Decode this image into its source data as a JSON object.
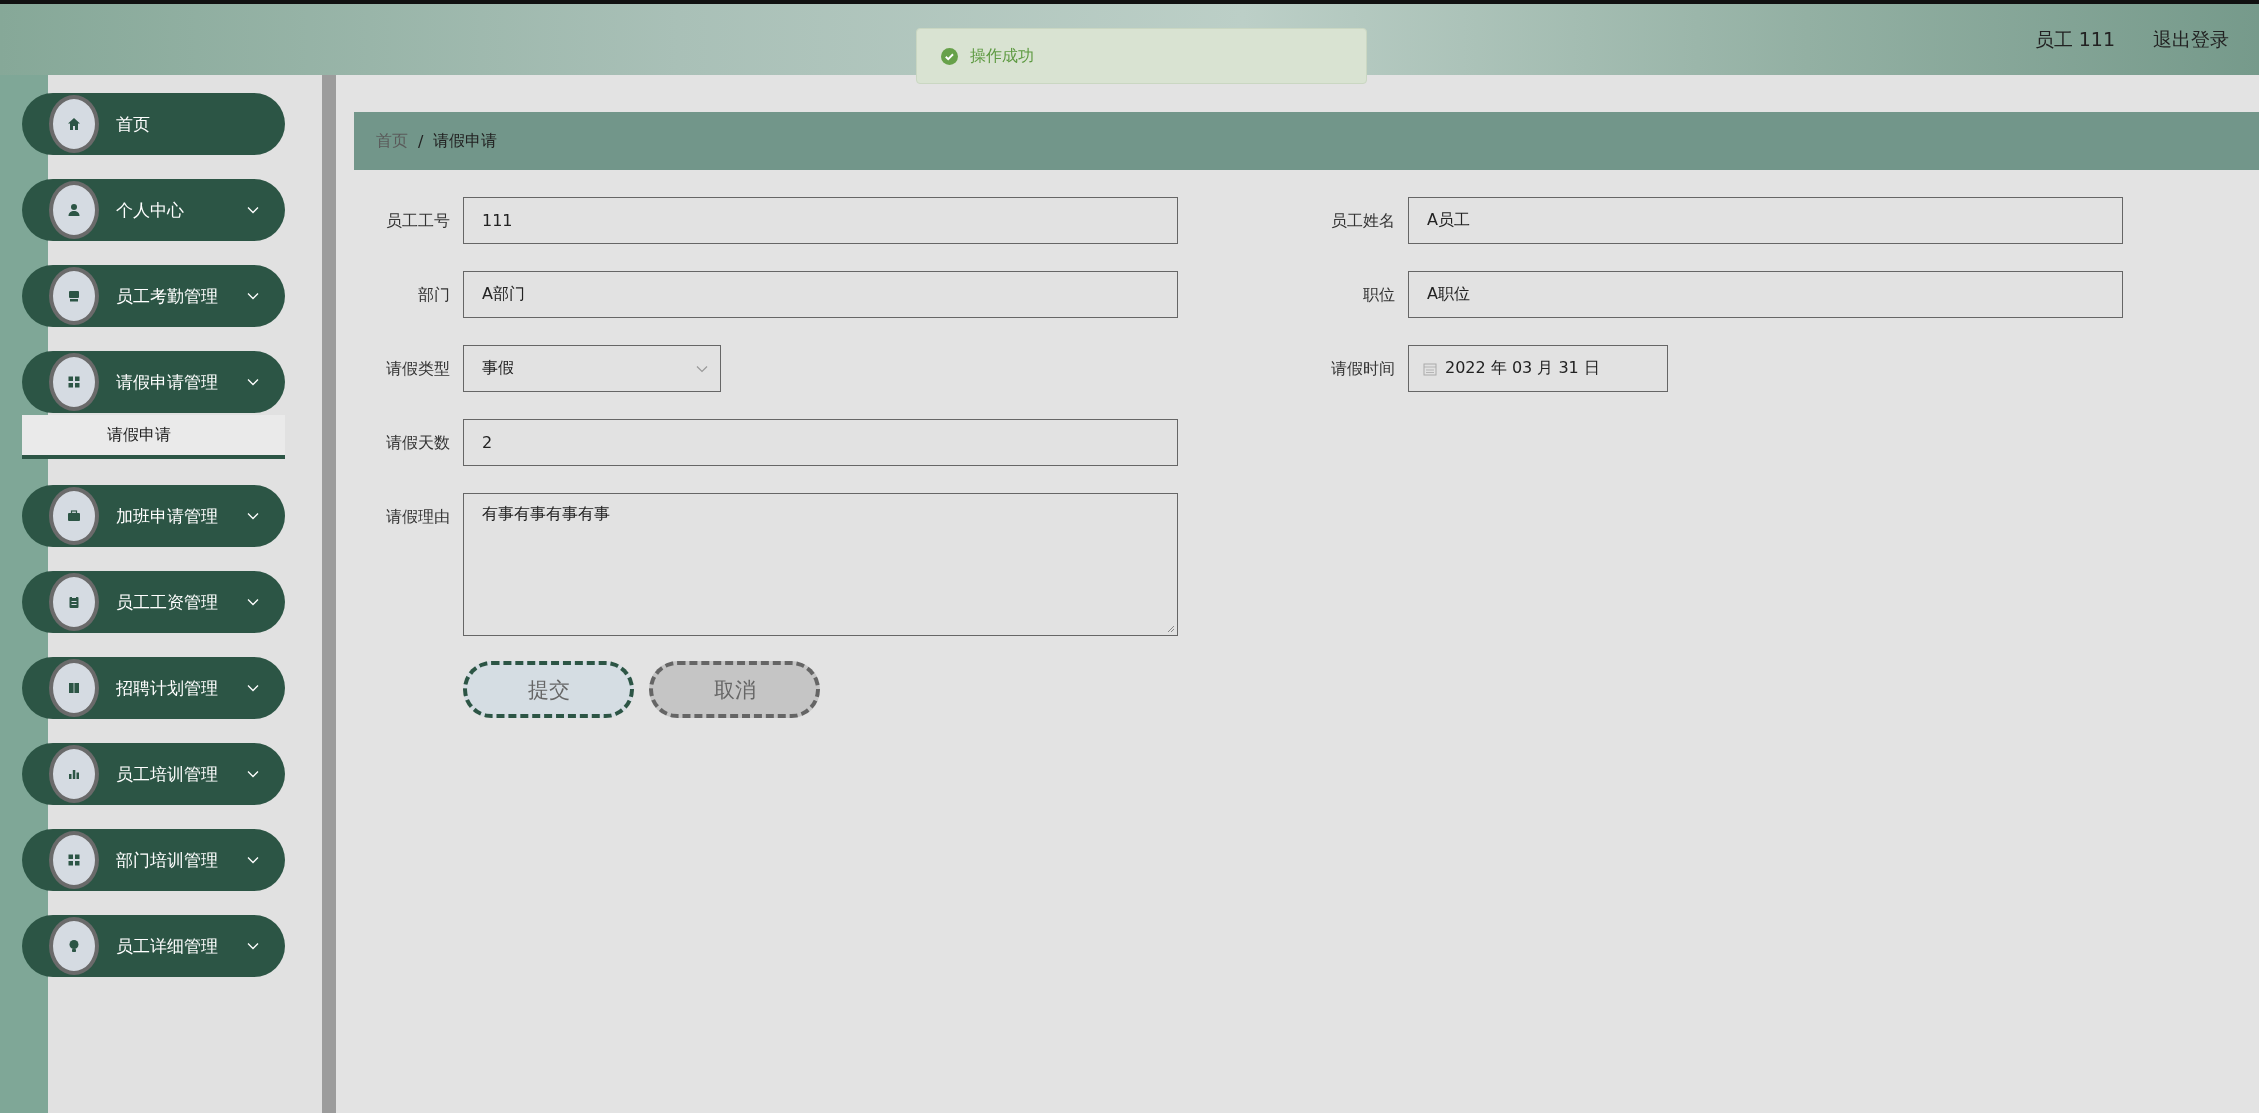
{
  "toast": {
    "kind": "success",
    "text": "操作成功"
  },
  "header": {
    "user": "员工 111",
    "logout": "退出登录"
  },
  "sidebar": {
    "items": [
      {
        "label": "首页",
        "expandable": false
      },
      {
        "label": "个人中心",
        "expandable": true
      },
      {
        "label": "员工考勤管理",
        "expandable": true
      },
      {
        "label": "请假申请管理",
        "expandable": true,
        "children": [
          {
            "label": "请假申请",
            "selected": true
          }
        ]
      },
      {
        "label": "加班申请管理",
        "expandable": true
      },
      {
        "label": "员工工资管理",
        "expandable": true
      },
      {
        "label": "招聘计划管理",
        "expandable": true
      },
      {
        "label": "员工培训管理",
        "expandable": true
      },
      {
        "label": "部门培训管理",
        "expandable": true
      },
      {
        "label": "员工详细管理",
        "expandable": true
      }
    ]
  },
  "breadcrumb": {
    "separator": "/",
    "items": [
      "首页",
      "请假申请"
    ]
  },
  "form": {
    "rows": [
      [
        {
          "label": "员工工号",
          "kind": "text",
          "value": "111"
        },
        {
          "label": "员工姓名",
          "kind": "text",
          "value": "A员工"
        }
      ],
      [
        {
          "label": "部门",
          "kind": "text",
          "value": "A部门"
        },
        {
          "label": "职位",
          "kind": "text",
          "value": "A职位"
        }
      ],
      [
        {
          "label": "请假类型",
          "kind": "select",
          "value": "事假"
        },
        {
          "label": "请假时间",
          "kind": "date",
          "value": "2022 年 03 月 31 日"
        }
      ],
      [
        {
          "label": "请假天数",
          "kind": "text",
          "value": "2"
        }
      ],
      [
        {
          "label": "请假理由",
          "kind": "textarea",
          "value": "有事有事有事有事"
        }
      ]
    ],
    "buttons": [
      {
        "label": "提交",
        "kind": "primary"
      },
      {
        "label": "取消",
        "kind": "cancel"
      }
    ]
  }
}
